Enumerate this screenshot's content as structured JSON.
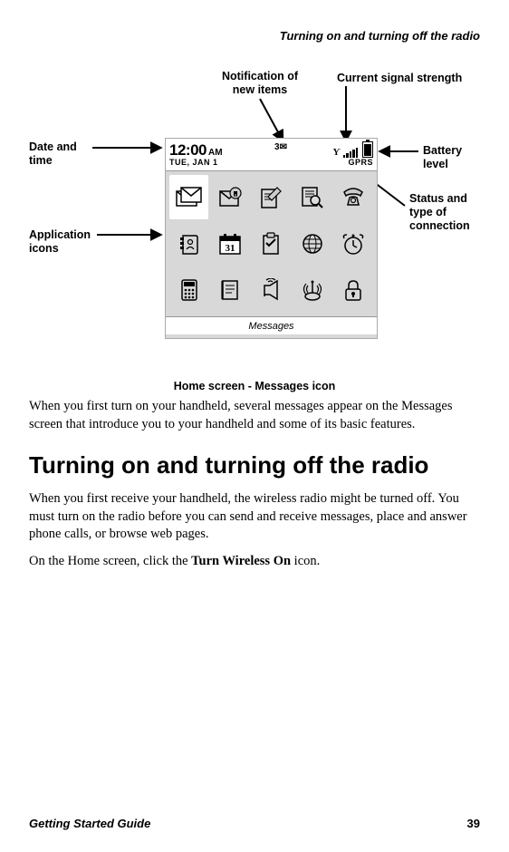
{
  "header": {
    "running_title": "Turning on and turning off the radio"
  },
  "diagram": {
    "callouts": {
      "notification": "Notification of\nnew items",
      "signal": "Current signal strength",
      "datetime": "Date and\ntime",
      "battery": "Battery\nlevel",
      "app_icons": "Application\nicons",
      "status_conn": "Status and\ntype of\nconnection"
    },
    "device": {
      "time": "12:00",
      "ampm": "AM",
      "date": "TUE, JAN 1",
      "notif_count": "3",
      "conn_label": "GPRS",
      "footer": "Messages"
    },
    "caption": "Home screen - Messages icon"
  },
  "body": {
    "intro_para": "When you first turn on your handheld, several messages appear on the Messages screen that introduce you to your handheld and some of its basic features.",
    "section_heading": "Turning on and turning off the radio",
    "para1": "When you first receive your handheld, the wireless radio might be turned off. You must turn on the radio before you can send and receive messages, place and answer phone calls, or browse web pages.",
    "para2_pre": "On the Home screen, click the ",
    "para2_bold": "Turn Wireless On",
    "para2_post": " icon."
  },
  "footer": {
    "guide": "Getting Started Guide",
    "page_number": "39"
  }
}
